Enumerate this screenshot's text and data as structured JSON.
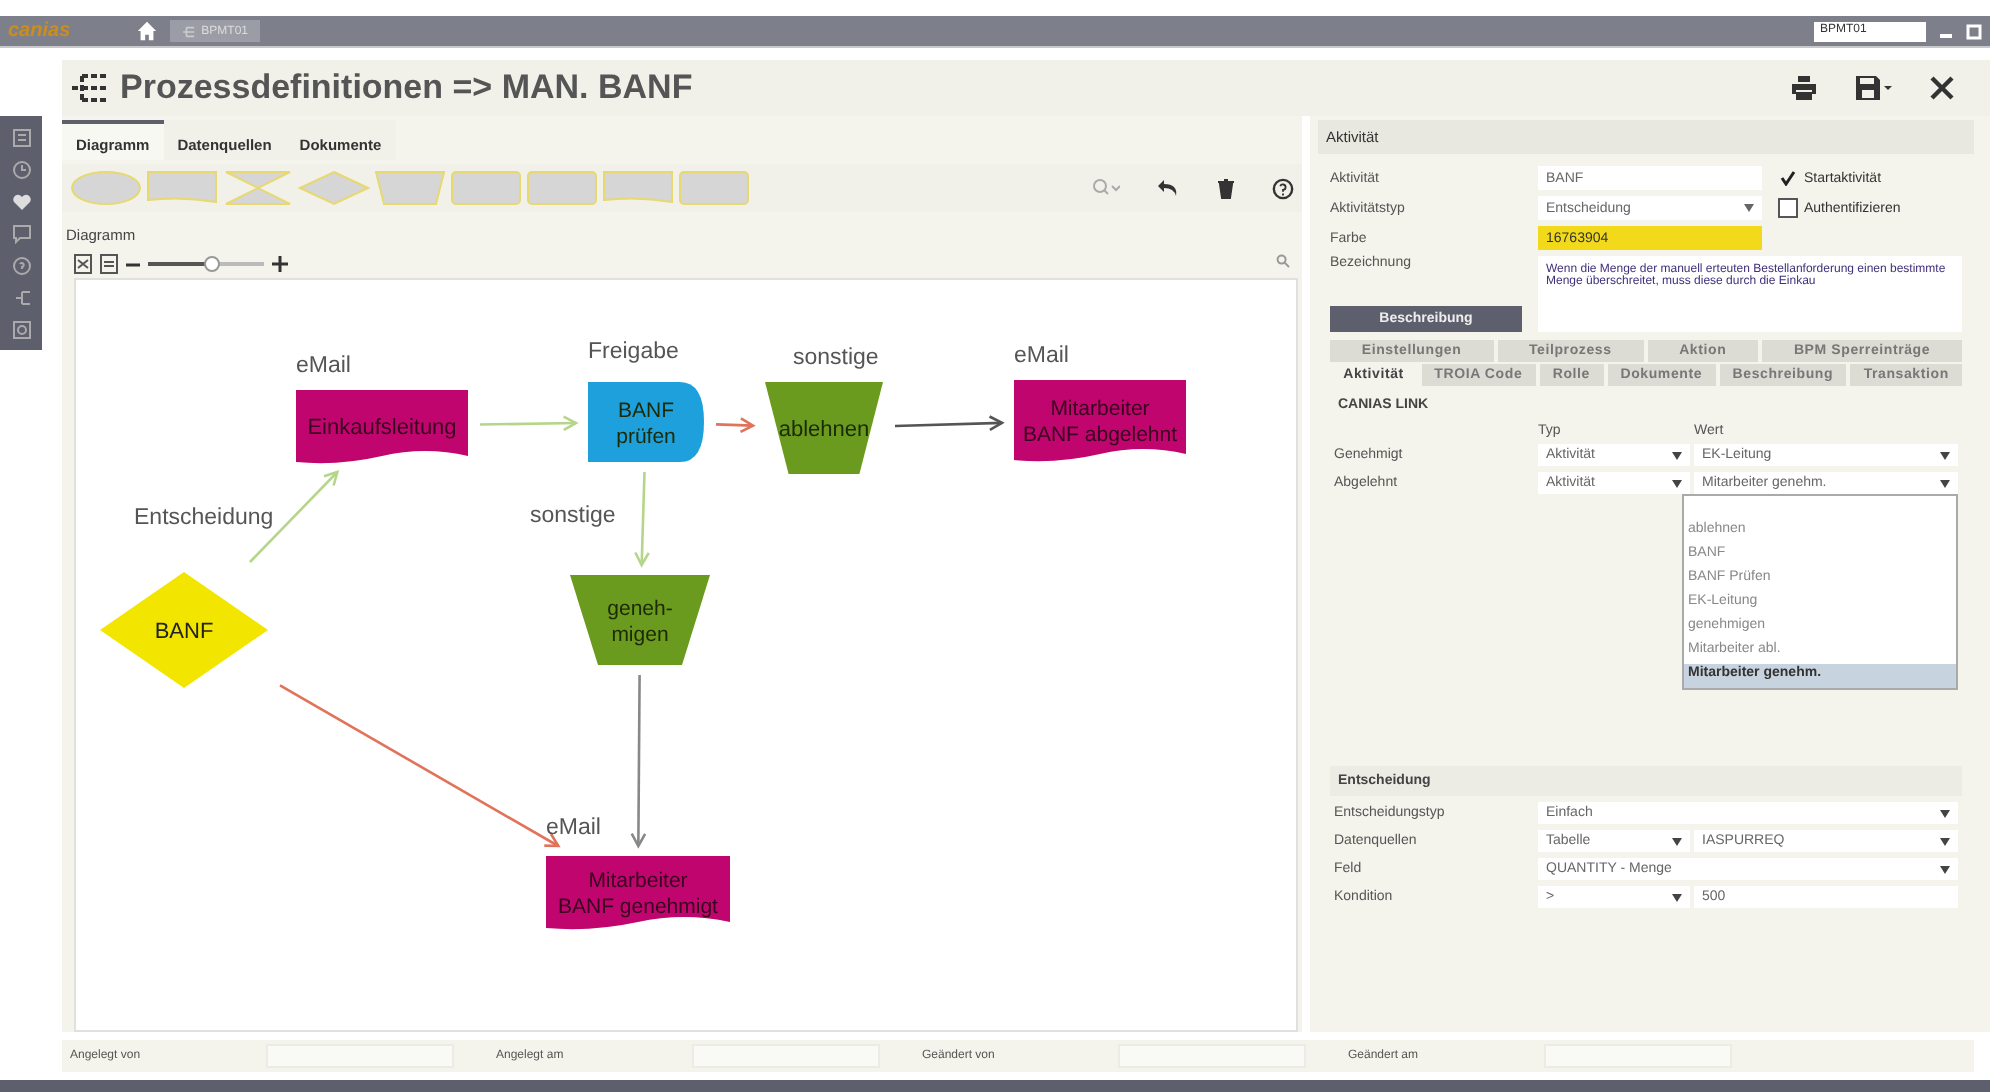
{
  "topbar": {
    "logo": "canias",
    "tab": "BPMT01",
    "search": "BPMT01"
  },
  "header": {
    "title": "Prozessdefinitionen => MAN. BANF"
  },
  "tabs": [
    {
      "label": "Diagramm",
      "selected": true
    },
    {
      "label": "Datenquellen",
      "selected": false
    },
    {
      "label": "Dokumente",
      "selected": false
    }
  ],
  "diagram": {
    "title": "Diagramm",
    "zoom": {
      "level": 0.55
    },
    "nodes": [
      {
        "kind": "decision",
        "label": "BANF",
        "caption": "Entscheidung",
        "color": "#f2e600"
      },
      {
        "kind": "document",
        "label": "Einkaufsleitung",
        "caption": "eMail",
        "color": "#c0066e"
      },
      {
        "kind": "process",
        "label": "BANF\nprüfen",
        "caption": "Freigabe",
        "color": "#1ea0dc"
      },
      {
        "kind": "trapezoid",
        "label": "ablehnen",
        "caption": "sonstige",
        "color": "#6a9a1e"
      },
      {
        "kind": "document",
        "label": "Mitarbeiter\nBANF abgelehnt",
        "caption": "eMail",
        "color": "#c0066e"
      },
      {
        "kind": "trapezoid",
        "label": "geneh-\nmigen",
        "caption": "sonstige",
        "color": "#6a9a1e"
      },
      {
        "kind": "document",
        "label": "Mitarbeiter\nBANF genehmigt",
        "caption": "eMail",
        "color": "#c0066e"
      }
    ],
    "edges": [
      {
        "color": "#b5d68a"
      },
      {
        "color": "#b5d68a"
      },
      {
        "color": "#e0735a"
      },
      {
        "color": "#555555"
      },
      {
        "color": "#b5d68a"
      },
      {
        "color": "#888888"
      },
      {
        "color": "#e0735a"
      }
    ]
  },
  "activity": {
    "title": "Aktivität",
    "fields": [
      {
        "label": "Aktivität",
        "value": "BANF"
      },
      {
        "label": "Aktivitätstyp",
        "value": "Entscheidung"
      },
      {
        "label": "Farbe",
        "value": "16763904"
      },
      {
        "label": "Bezeichnung",
        "value": "Wenn die Menge der manuell erteuten Bestellanforderung einen bestimmte Menge überschreitet, muss diese durch die Einkau"
      }
    ],
    "checks": [
      {
        "label": "Startaktivität",
        "checked": true
      },
      {
        "label": "Authentifizieren",
        "checked": false
      }
    ],
    "button": "Beschreibung"
  },
  "tab_rows": [
    [
      {
        "label": "Einstellungen",
        "selected": false
      },
      {
        "label": "Teilprozess",
        "selected": false
      },
      {
        "label": "Aktion",
        "selected": false
      },
      {
        "label": "BPM Sperreinträge",
        "selected": false
      }
    ],
    [
      {
        "label": "Aktivität",
        "selected": true
      },
      {
        "label": "TROIA Code",
        "selected": false
      },
      {
        "label": "Rolle",
        "selected": false
      },
      {
        "label": "Dokumente",
        "selected": false
      },
      {
        "label": "Beschreibung",
        "selected": false
      },
      {
        "label": "Transaktion",
        "selected": false
      }
    ]
  ],
  "link": {
    "title": "CANIAS LINK",
    "col_type": "Typ",
    "col_value": "Wert",
    "rows": [
      {
        "label": "Genehmigt",
        "type": "Aktivität",
        "value": "EK-Leitung"
      },
      {
        "label": "Abgelehnt",
        "type": "Aktivität",
        "value": "Mitarbeiter genehm."
      }
    ],
    "dropdown": [
      {
        "label": "ablehnen",
        "selected": false
      },
      {
        "label": "BANF",
        "selected": false
      },
      {
        "label": "BANF Prüfen",
        "selected": false
      },
      {
        "label": "EK-Leitung",
        "selected": false
      },
      {
        "label": "genehmigen",
        "selected": false
      },
      {
        "label": "Mitarbeiter abl.",
        "selected": false
      },
      {
        "label": "Mitarbeiter genehm.",
        "selected": true
      }
    ]
  },
  "decision": {
    "title": "Entscheidung",
    "rows": [
      {
        "label": "Entscheidungstyp",
        "values": [
          "Einfach"
        ]
      },
      {
        "label": "Datenquellen",
        "values": [
          "Tabelle",
          "IASPURREQ"
        ]
      },
      {
        "label": "Feld",
        "values": [
          "QUANTITY - Menge"
        ]
      },
      {
        "label": "Kondition",
        "values": [
          ">",
          "500"
        ]
      }
    ]
  },
  "footer": [
    {
      "label": "Angelegt von"
    },
    {
      "label": "Angelegt am"
    },
    {
      "label": "Geändert von"
    },
    {
      "label": "Geändert am"
    }
  ]
}
